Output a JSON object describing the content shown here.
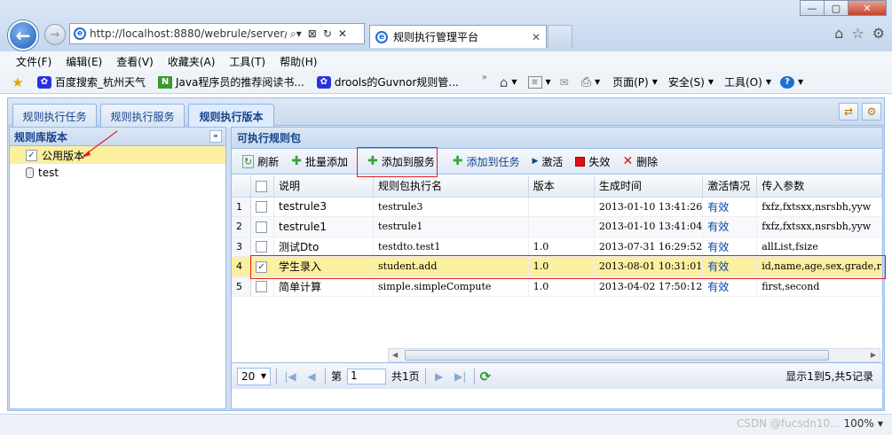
{
  "browser": {
    "url": "http://localhost:8880/webrule/server/#",
    "tab_title": "规则执行管理平台",
    "window_controls": [
      "—",
      "▢",
      "✕"
    ],
    "menu": [
      "文件(F)",
      "编辑(E)",
      "查看(V)",
      "收藏夹(A)",
      "工具(T)",
      "帮助(H)"
    ],
    "favorites": [
      "百度搜索_杭州天气",
      "Java程序员的推荐阅读书...",
      "drools的Guvnor规则管..."
    ],
    "commands": [
      "页面(P)",
      "安全(S)",
      "工具(O)"
    ],
    "zoom": "100%",
    "watermark": "CSDN @fucsdn10..."
  },
  "app": {
    "tabs": [
      "规则执行任务",
      "规则执行服务",
      "规则执行版本"
    ],
    "active_tab": 2,
    "left_panel": {
      "title": "规则库版本",
      "nodes": [
        {
          "label": "公用版本",
          "selected": true
        },
        {
          "label": "test",
          "selected": false
        }
      ]
    },
    "right_panel": {
      "title": "可执行规则包",
      "toolbar": {
        "refresh": "刷新",
        "batch_add": "批量添加",
        "add_to_service": "添加到服务",
        "add_to_task": "添加到任务",
        "activate": "激活",
        "deactivate": "失效",
        "delete": "删除"
      },
      "columns": [
        "说明",
        "规则包执行名",
        "版本",
        "生成时间",
        "激活情况",
        "传入参数"
      ],
      "rows": [
        {
          "n": "1",
          "checked": false,
          "desc": "testrule3",
          "name": "testrule3",
          "ver": "",
          "time": "2013-01-10 13:41:26",
          "status": "有效",
          "params": "fxfz,fxtsxx,nsrsbh,yyw"
        },
        {
          "n": "2",
          "checked": false,
          "desc": "testrule1",
          "name": "testrule1",
          "ver": "",
          "time": "2013-01-10 13:41:04",
          "status": "有效",
          "params": "fxfz,fxtsxx,nsrsbh,yyw"
        },
        {
          "n": "3",
          "checked": false,
          "desc": "测试Dto",
          "name": "testdto.test1",
          "ver": "1.0",
          "time": "2013-07-31 16:29:52",
          "status": "有效",
          "params": "allList,fsize"
        },
        {
          "n": "4",
          "checked": true,
          "desc": "学生录入",
          "name": "student.add",
          "ver": "1.0",
          "time": "2013-08-01 10:31:01",
          "status": "有效",
          "params": "id,name,age,sex,grade,r"
        },
        {
          "n": "5",
          "checked": false,
          "desc": "简单计算",
          "name": "simple.simpleCompute",
          "ver": "1.0",
          "time": "2013-04-02 17:50:12",
          "status": "有效",
          "params": "first,second"
        }
      ],
      "pager": {
        "page_size": "20",
        "page_prefix": "第",
        "page_value": "1",
        "page_suffix": "共1页",
        "info": "显示1到5,共5记录"
      }
    }
  }
}
